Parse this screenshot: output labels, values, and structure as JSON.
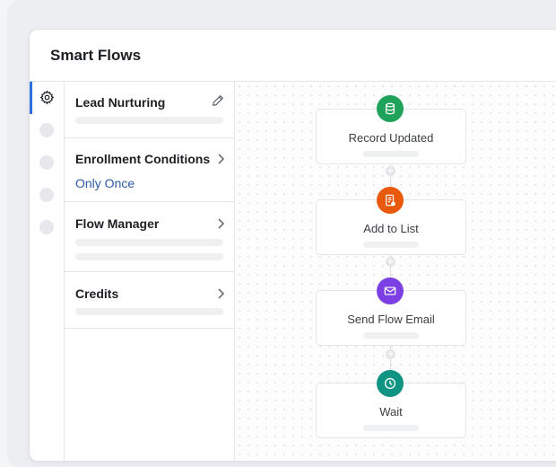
{
  "app": {
    "title": "Smart Flows"
  },
  "colors": {
    "accent": "#2e6fe0",
    "link": "#2b5aa8",
    "record_updated": "#1fa35a",
    "add_to_list": "#e8590c",
    "send_flow_email": "#7b3fe4",
    "wait": "#0f9484"
  },
  "sidebar": {
    "rail_icons": [
      "gear-icon"
    ],
    "sections": [
      {
        "title": "Lead Nurturing",
        "action_icon": "pencil-icon"
      },
      {
        "title": "Enrollment Conditions",
        "value": "Only Once",
        "action_icon": "chevron-right-icon"
      },
      {
        "title": "Flow Manager",
        "action_icon": "chevron-right-icon"
      },
      {
        "title": "Credits",
        "action_icon": "chevron-right-icon"
      }
    ]
  },
  "flow": {
    "nodes": [
      {
        "label": "Record Updated",
        "icon": "database-icon"
      },
      {
        "label": "Add to List",
        "icon": "list-document-icon"
      },
      {
        "label": "Send Flow Email",
        "icon": "envelope-icon"
      },
      {
        "label": "Wait",
        "icon": "clock-icon"
      }
    ],
    "add_step_icon": "plus-icon"
  }
}
